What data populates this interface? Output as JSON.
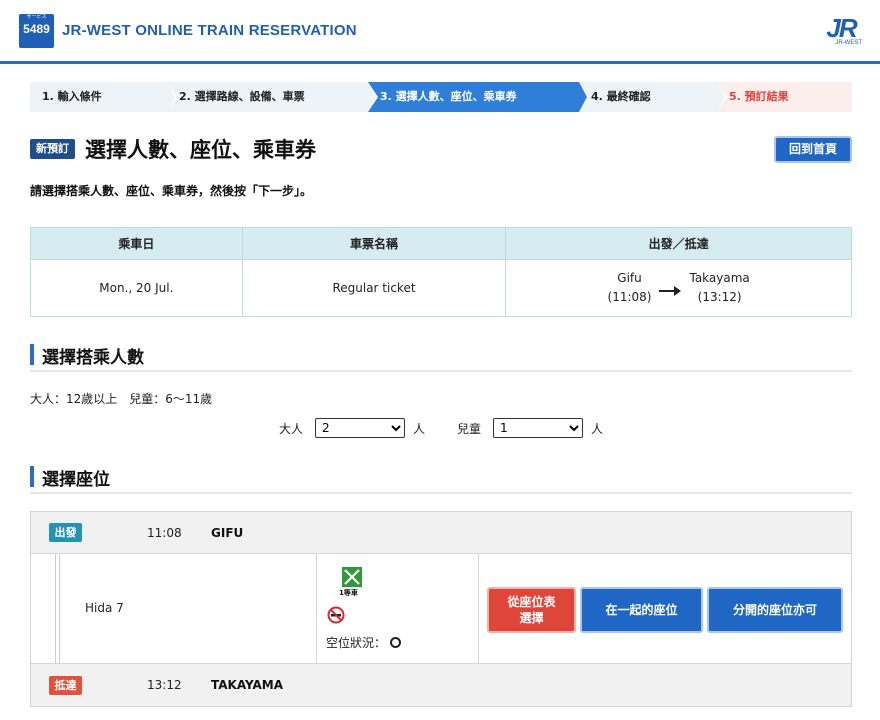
{
  "header": {
    "logo_number": "5489",
    "logo_sub": "サービス",
    "brand": "JR-WEST ONLINE TRAIN RESERVATION",
    "jr_mark": "JR",
    "jr_sub": "JR-WEST",
    "accent_color": "#1f5fb8"
  },
  "steps": [
    {
      "label": "1.  輸入條件",
      "state": "done"
    },
    {
      "label": "2.  選擇路線、設備、車票",
      "state": "done"
    },
    {
      "label": "3.  選擇人數、座位、乘車券",
      "state": "current"
    },
    {
      "label": "4.  最終確認",
      "state": "pending"
    },
    {
      "label": "5.  預訂結果",
      "state": "result"
    }
  ],
  "title": {
    "badge": "新預訂",
    "text": "選擇人數、座位、乘車券",
    "home_button": "回到首頁"
  },
  "instruction": "請選擇搭乘人數、座位、乘車券，然後按「下一步」。",
  "ticket_table": {
    "headers": [
      "乘車日",
      "車票名稱",
      "出發／抵達"
    ],
    "date": "Mon., 20 Jul.",
    "ticket_name": "Regular ticket",
    "from_station": "Gifu",
    "from_time": "(11:08)",
    "to_station": "Takayama",
    "to_time": "(13:12)"
  },
  "passengers": {
    "section_title": "選擇搭乘人數",
    "age_note": "大人：12歲以上　兒童：6〜11歲",
    "adult_label": "大人",
    "adult_value": "2",
    "child_label": "兒童",
    "child_value": "1",
    "unit": "人"
  },
  "seats": {
    "section_title": "選擇座位",
    "departure_tag": "出發",
    "departure_time": "11:08",
    "departure_station": "GIFU",
    "train_name": "Hida 7",
    "green_car_label": "1等車",
    "availability_label": "空位狀況：",
    "btn_seat_map": "從座位表\n選擇",
    "btn_together": "在一起的座位",
    "btn_separate": "分開的座位亦可",
    "arrival_tag": "抵達",
    "arrival_time": "13:12",
    "arrival_station": "TAKAYAMA"
  }
}
